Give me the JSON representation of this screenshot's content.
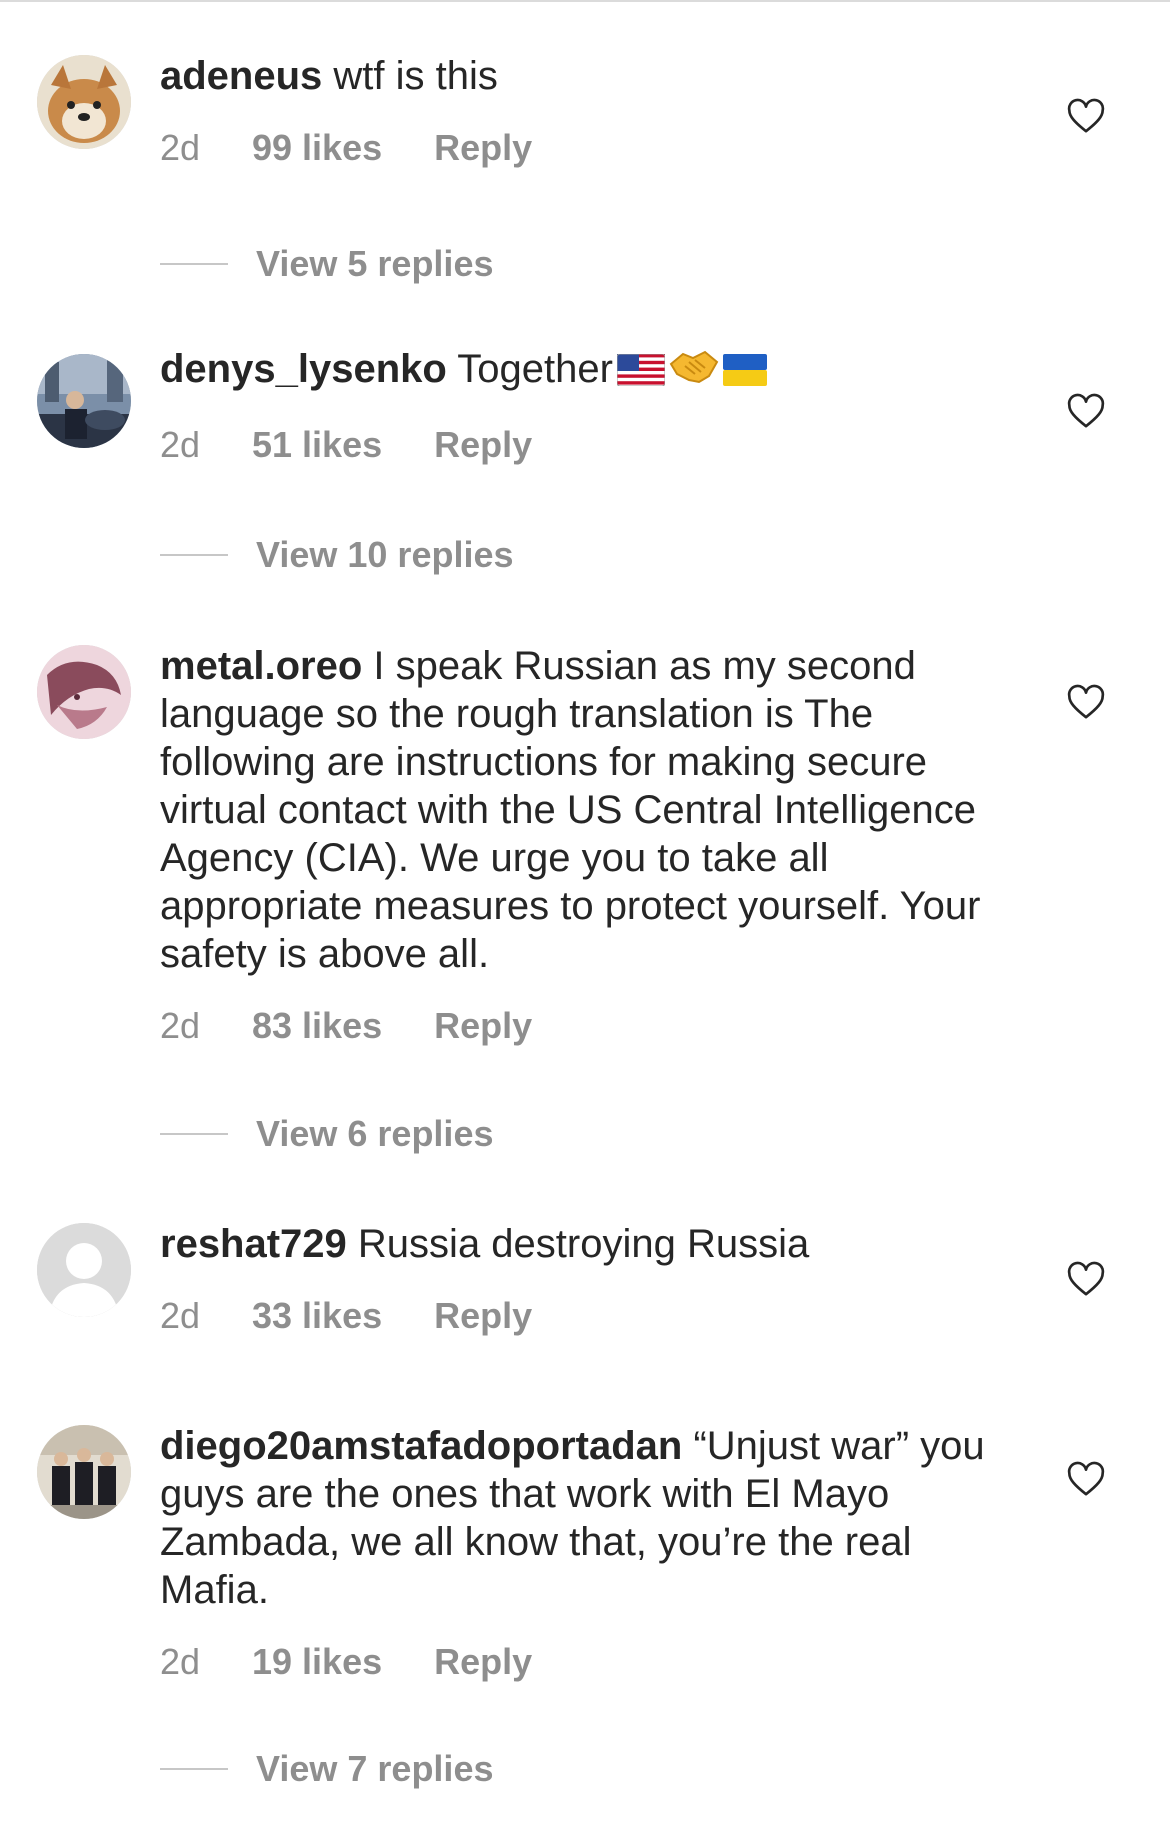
{
  "comments": [
    {
      "username": "adeneus",
      "text": "wtf is this",
      "time": "2d",
      "likes": "99 likes",
      "reply": "Reply",
      "view_replies": "View 5 replies",
      "avatar_colors": [
        "#e9d7b8",
        "#c98a4a"
      ]
    },
    {
      "username": "denys_lysenko",
      "text": "Together",
      "emojis": [
        "🇺🇸",
        "🤝",
        "🇺🇦"
      ],
      "time": "2d",
      "likes": "51 likes",
      "reply": "Reply",
      "view_replies": "View 10 replies",
      "avatar_colors": [
        "#3b4e6b",
        "#7b8fa8"
      ]
    },
    {
      "username": "metal.oreo",
      "text": "I speak Russian as my second language so the rough translation is The following are instructions for making secure virtual contact with the US Central Intelligence Agency (CIA). We urge you to take all appropriate measures to protect yourself. Your safety is above all.",
      "time": "2d",
      "likes": "83 likes",
      "reply": "Reply",
      "view_replies": "View 6 replies",
      "avatar_colors": [
        "#e8c9d2",
        "#8a4b5c"
      ]
    },
    {
      "username": "reshat729",
      "text": "Russia destroying Russia",
      "time": "2d",
      "likes": "33 likes",
      "reply": "Reply",
      "avatar_colors": [
        "#dbdbdb",
        "#ffffff"
      ]
    },
    {
      "username": "diego20amstafadoportadan",
      "text": "“Unjust war” you guys are the ones that work with El Mayo Zambada, we all know that, you’re the real Mafia.",
      "time": "2d",
      "likes": "19 likes",
      "reply": "Reply",
      "view_replies": "View 7 replies",
      "avatar_colors": [
        "#d9d2c5",
        "#1e1e24"
      ]
    }
  ],
  "colors": {
    "text": "#262626",
    "secondary": "#8e8e8e",
    "divider": "#dbdbdb"
  }
}
